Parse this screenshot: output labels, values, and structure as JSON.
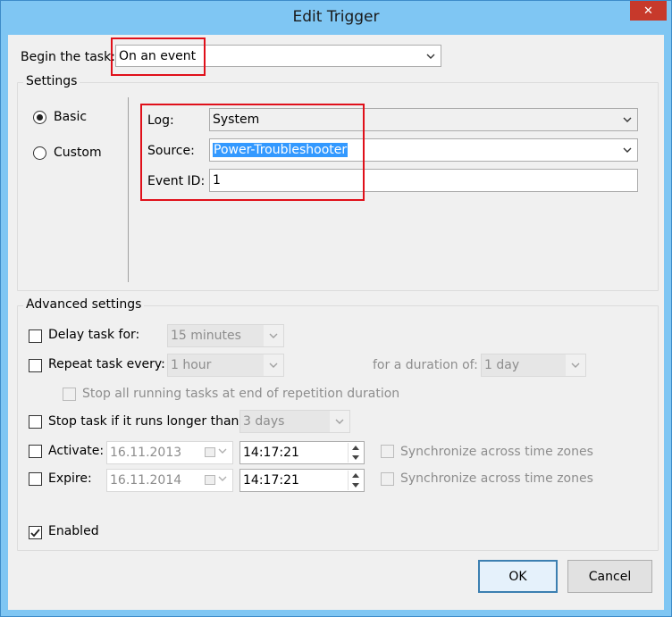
{
  "window": {
    "title": "Edit Trigger"
  },
  "begin_task": {
    "label": "Begin the task:",
    "value": "On an event"
  },
  "settings": {
    "caption": "Settings",
    "basic_label": "Basic",
    "custom_label": "Custom",
    "selected": "Basic",
    "log": {
      "label": "Log:",
      "value": "System"
    },
    "source": {
      "label": "Source:",
      "value": "Power-Troubleshooter"
    },
    "event_id": {
      "label": "Event ID:",
      "value": "1"
    }
  },
  "advanced": {
    "caption": "Advanced settings",
    "delay": {
      "label": "Delay task for:",
      "value": "15 minutes",
      "checked": false
    },
    "repeat": {
      "label": "Repeat task every:",
      "value": "1 hour",
      "duration_label": "for a duration of:",
      "duration_value": "1 day",
      "checked": false
    },
    "stop_all": {
      "label": "Stop all running tasks at end of repetition duration",
      "checked": false
    },
    "stop_if": {
      "label": "Stop task if it runs longer than:",
      "value": "3 days",
      "checked": false
    },
    "activate": {
      "label": "Activate:",
      "date": "16.11.2013",
      "time": "14:17:21",
      "sync_label": "Synchronize across time zones",
      "checked": false
    },
    "expire": {
      "label": "Expire:",
      "date": "16.11.2014",
      "time": "14:17:21",
      "sync_label": "Synchronize across time zones",
      "checked": false
    },
    "enabled": {
      "label": "Enabled",
      "checked": true
    }
  },
  "buttons": {
    "ok": "OK",
    "cancel": "Cancel"
  },
  "colors": {
    "highlight": "#e0101a",
    "titlebar": "#7fc6f3",
    "close": "#c7392b",
    "selection": "#3399ff"
  }
}
